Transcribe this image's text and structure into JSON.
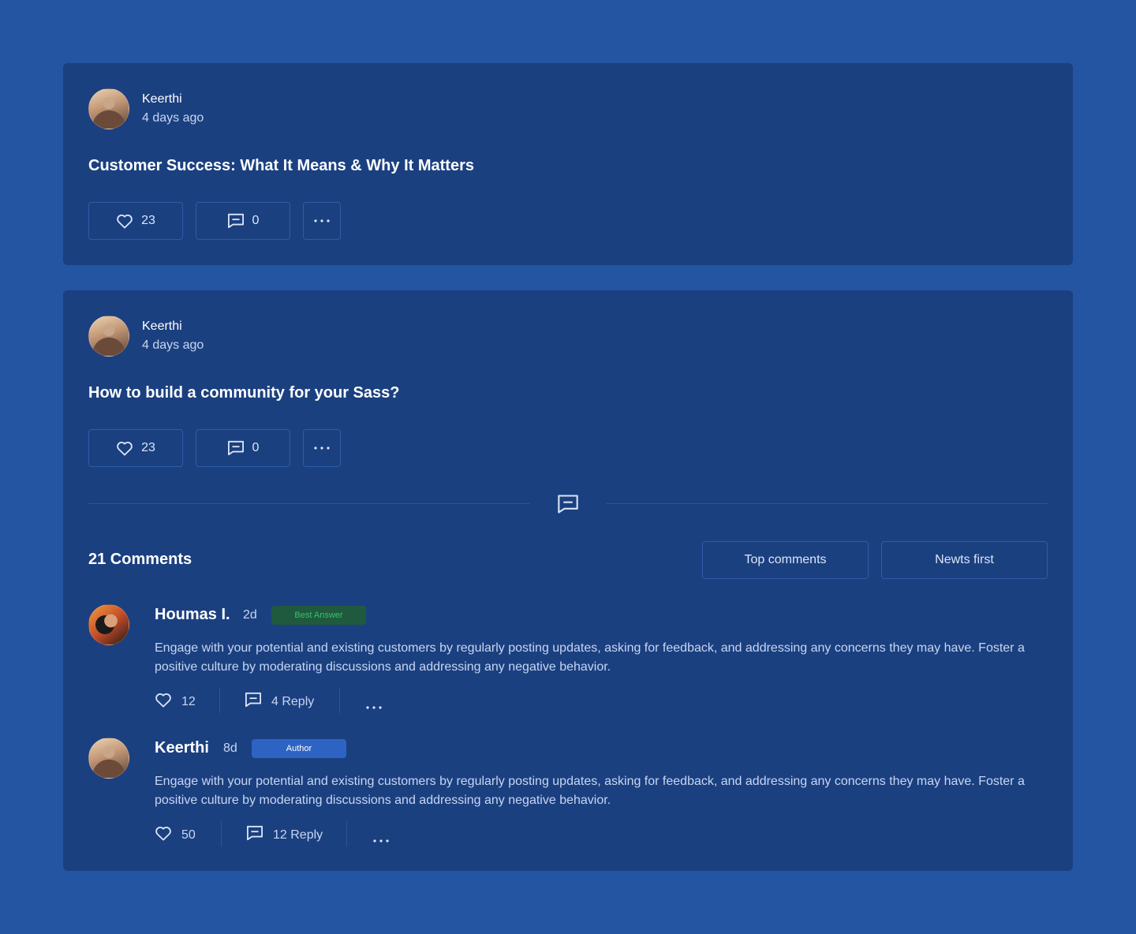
{
  "posts": [
    {
      "author": "Keerthi",
      "time": "4 days ago",
      "title": "Customer Success: What It Means & Why It Matters",
      "likes": "23",
      "comments": "0"
    },
    {
      "author": "Keerthi",
      "time": "4 days ago",
      "title": "How to build a community for your Sass?",
      "likes": "23",
      "comments": "0"
    }
  ],
  "comments_section": {
    "title": "21 Comments",
    "sort_options": [
      "Top comments",
      "Newts first"
    ],
    "comments": [
      {
        "author": "Houmas I.",
        "time": "2d",
        "badge": "Best Answer",
        "badge_color": "#36c26a",
        "body": "Engage with your potential and existing customers by regularly posting updates, asking for feedback, and addressing any concerns they may have. Foster a positive culture by moderating discussions and addressing any negative behavior.",
        "likes": "12",
        "replies": "4 Reply"
      },
      {
        "author": "Keerthi",
        "time": "8d",
        "badge": "Author",
        "badge_color": "#2d64c4",
        "body": "Engage with your potential and existing customers by regularly posting updates, asking for feedback, and addressing any concerns they may have. Foster a positive culture by moderating discussions and addressing any negative behavior.",
        "likes": "50",
        "replies": "12 Reply"
      }
    ]
  },
  "icons": {
    "like": "heart-icon",
    "comment": "comment-icon",
    "more": "more-dots-icon"
  },
  "colors": {
    "page_background": "#2355a3",
    "card_background": "#1b4080",
    "border": "#2f5ca6"
  }
}
